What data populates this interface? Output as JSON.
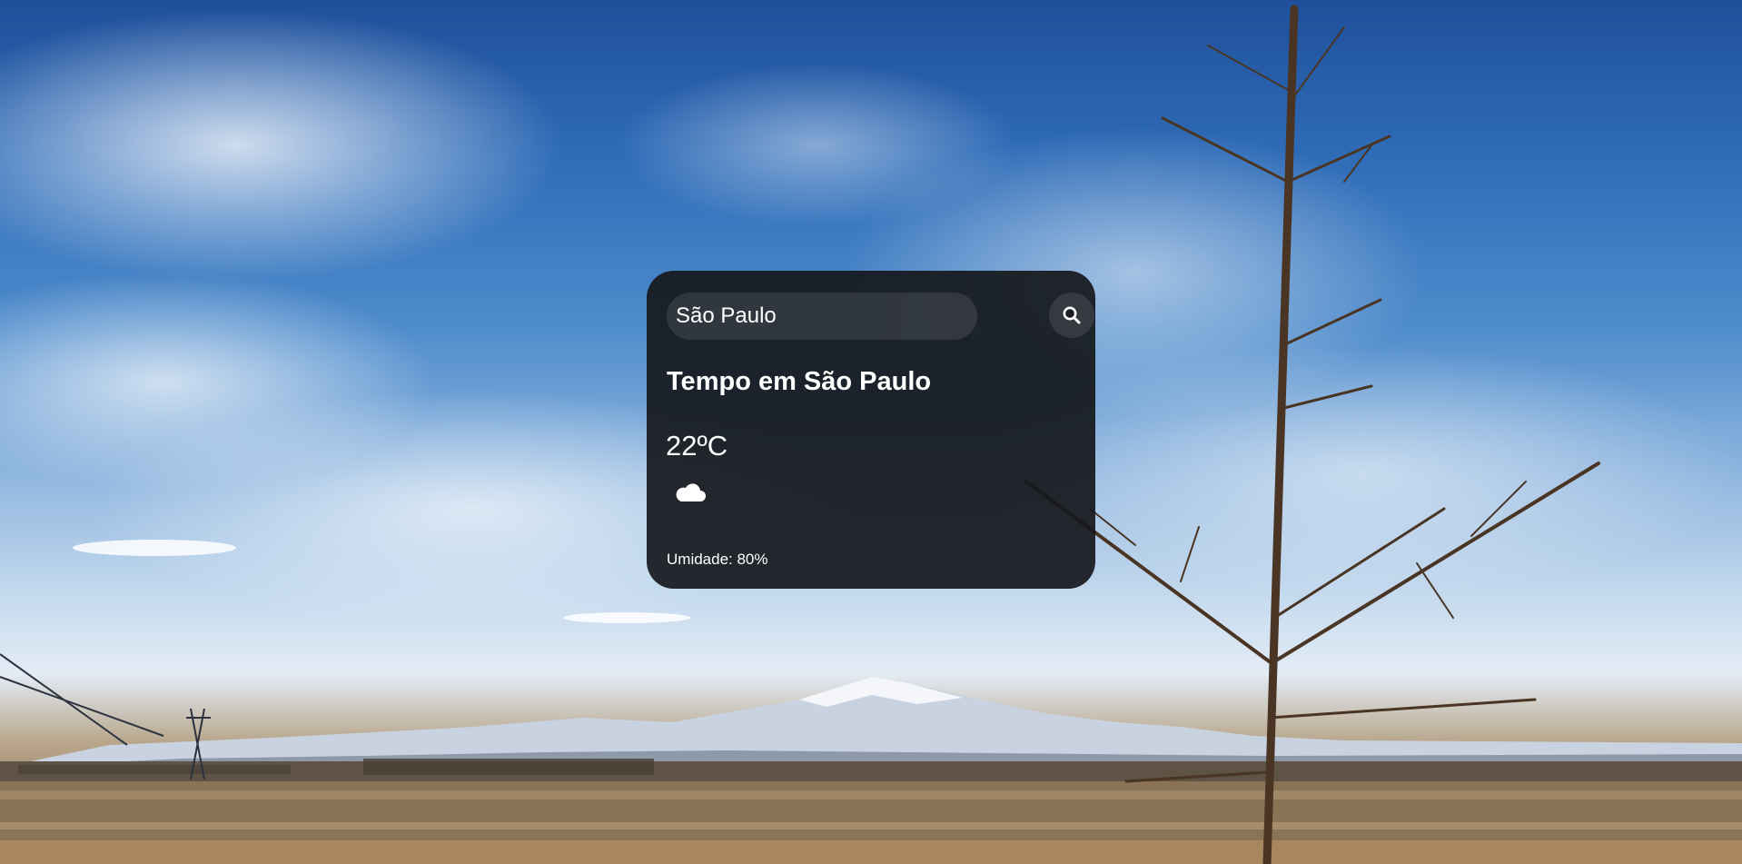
{
  "search": {
    "value": "São Paulo",
    "placeholder": ""
  },
  "weather": {
    "title": "Tempo em São Paulo",
    "temperature": "22ºC",
    "icon": "cloud-icon",
    "humidity_label": "Umidade: 80%"
  },
  "icons": {
    "search": "search-icon"
  }
}
